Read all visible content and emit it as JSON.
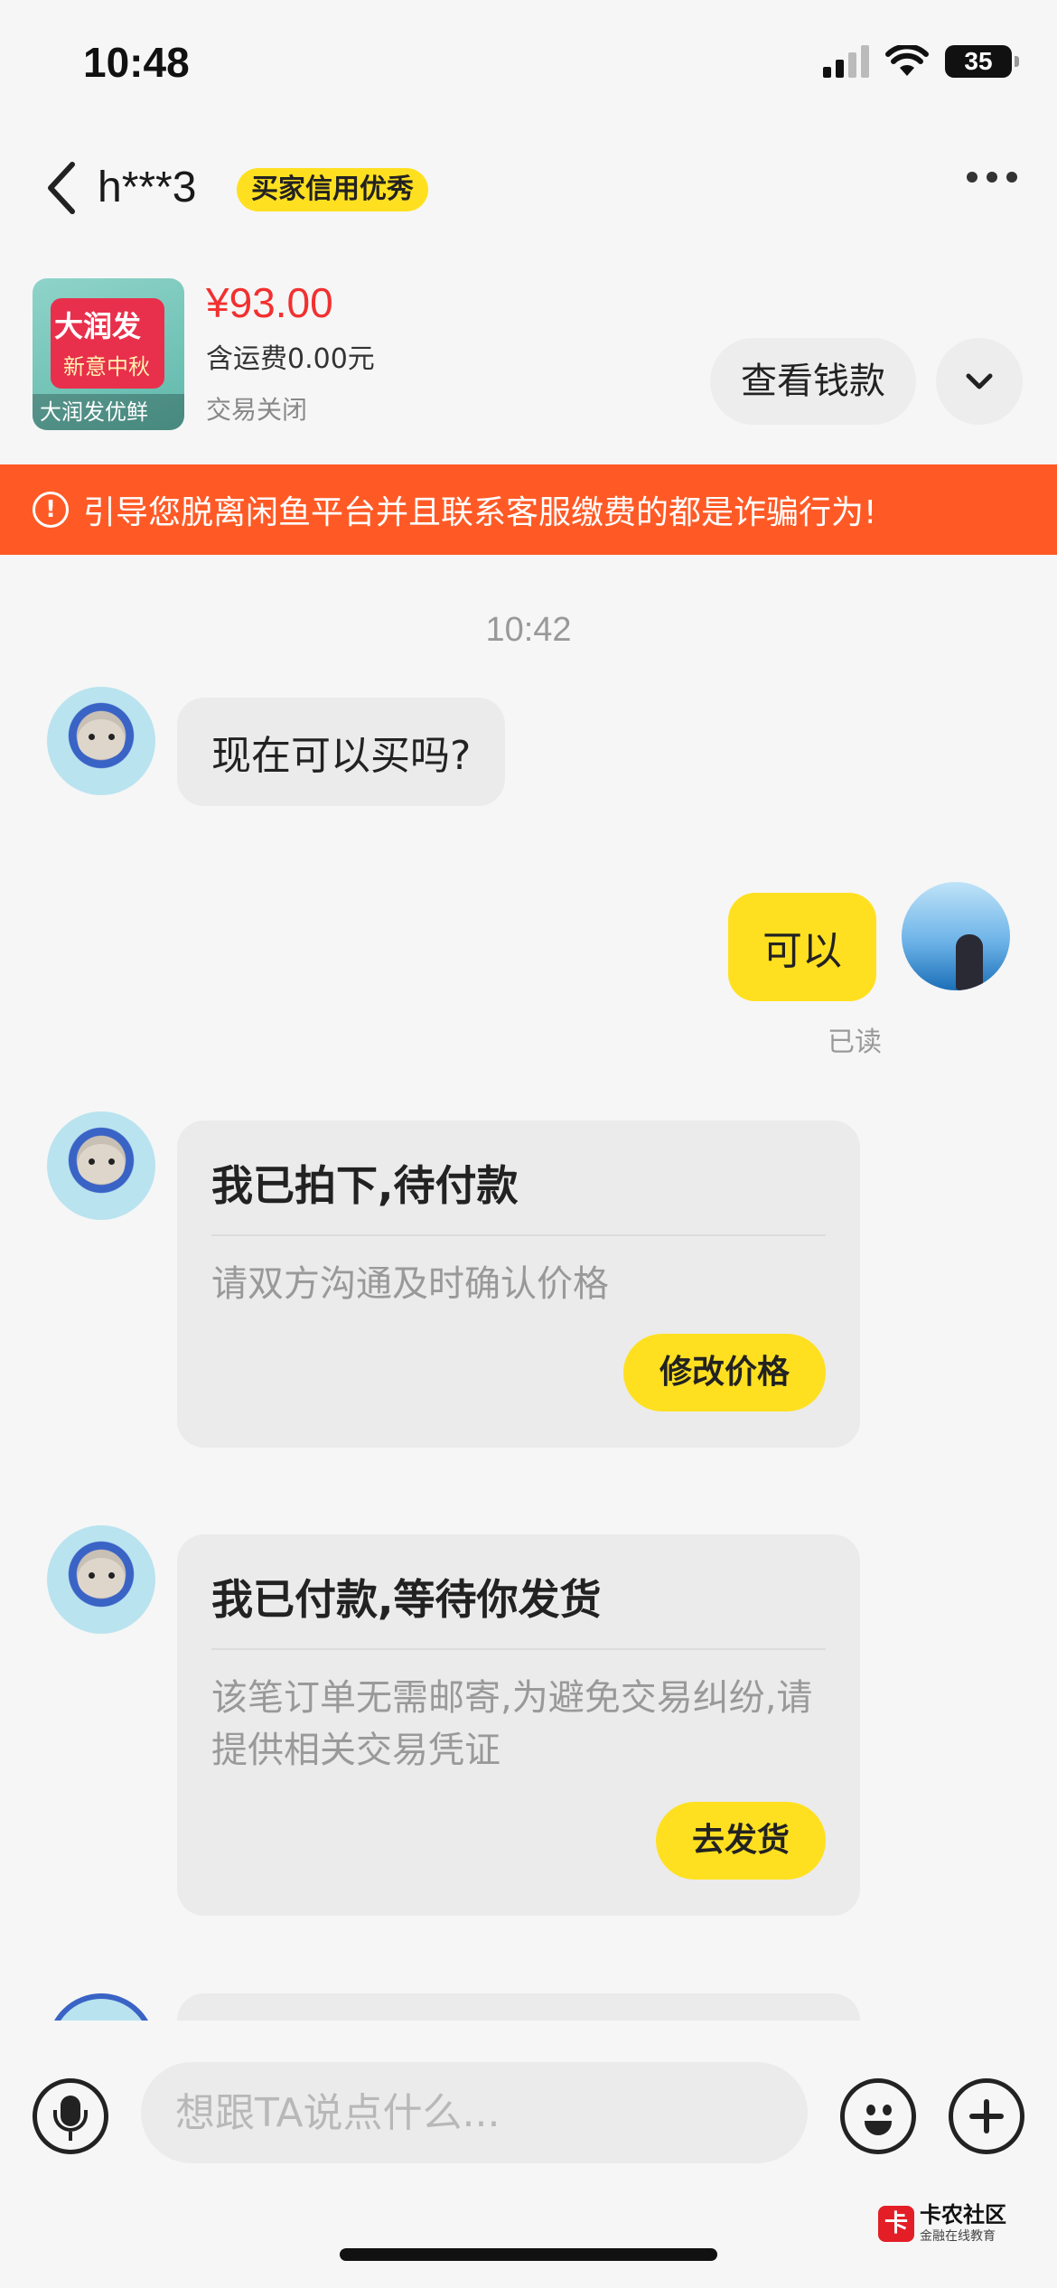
{
  "status_bar": {
    "time": "10:48",
    "battery": "35"
  },
  "header": {
    "title": "h***3",
    "badge": "买家信用优秀"
  },
  "product": {
    "image_text_main": "大润发",
    "image_text_sub": "新意中秋",
    "image_caption": "大润发优鲜",
    "price": "¥93.00",
    "shipping": "含运费0.00元",
    "status": "交易关闭",
    "view_button": "查看钱款"
  },
  "warning": {
    "text": "引导您脱离闲鱼平台并且联系客服缴费的都是诈骗行为!"
  },
  "chat": {
    "timestamp": "10:42",
    "msg1": "现在可以买吗?",
    "msg2": "可以",
    "read_status": "已读",
    "card1": {
      "title": "我已拍下,待付款",
      "desc": "请双方沟通及时确认价格",
      "button": "修改价格"
    },
    "card2": {
      "title": "我已付款,等待你发货",
      "desc": "该笔订单无需邮寄,为避免交易纠纷,请提供相关交易凭证",
      "button": "去发货"
    }
  },
  "input": {
    "placeholder": "想跟TA说点什么..."
  },
  "watermark": {
    "title": "卡农社区",
    "subtitle": "金融在线教育"
  },
  "colors": {
    "accent_yellow": "#ffe020",
    "warning_orange": "#ff5a26",
    "price_red": "#f23030"
  }
}
